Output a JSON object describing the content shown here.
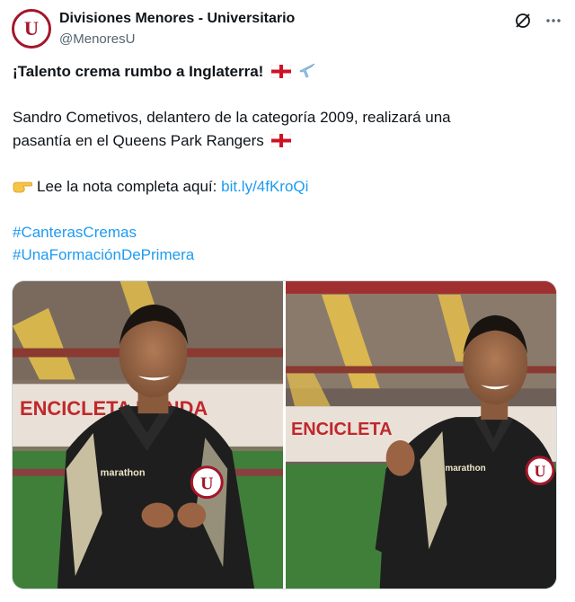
{
  "author": {
    "display_name": "Divisiones Menores - Universitario",
    "handle": "@MenoresU",
    "avatar_letter": "U"
  },
  "header_icons": [
    "grok-icon",
    "more-options-icon"
  ],
  "tweet": {
    "headline": "¡Talento crema rumbo a Inglaterra!",
    "body_line_1": "Sandro Cometivos, delantero de la categoría 2009, realizará una",
    "body_line_2": "pasantía en el Queens Park Rangers",
    "read_more_label": "Lee la nota completa aquí:",
    "link": "bit.ly/4fKroQi",
    "hashtag_1": "#CanterasCremas",
    "hashtag_2": "#UnaFormaciónDePrimera"
  },
  "media": {
    "photos": [
      {
        "shirt_brand": "marathon",
        "crest_letter": "U",
        "banner": "ENCICLETA HONDA"
      },
      {
        "shirt_brand": "marathon",
        "crest_letter": "U",
        "banner": "ENCICLETA"
      }
    ]
  },
  "colors": {
    "link": "#1d9bf0",
    "brand_red": "#a3162a",
    "stadium_seat_yellow": "#e8c24a",
    "pitch_green": "#3f7f3a"
  }
}
